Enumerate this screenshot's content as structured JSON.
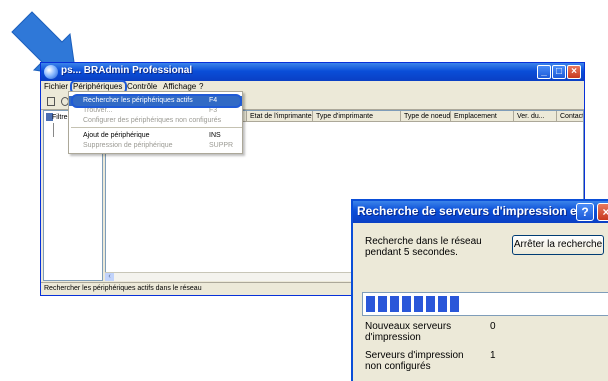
{
  "window": {
    "title": "ps... BRAdmin Professional",
    "menu": [
      "Fichier",
      "Périphériques",
      "Contrôle",
      "Affichage",
      "?"
    ]
  },
  "tree": {
    "filter_label": "Filtre"
  },
  "list": {
    "columns": [
      "...",
      "Etat de l'imprimante",
      "Type d'imprimante",
      "Type de noeud",
      "Emplacement",
      "Ver. du...",
      "Contact"
    ]
  },
  "status_bar": "Rechercher les périphériques actifs dans le réseau",
  "dropdown": {
    "items": [
      {
        "label": "Rechercher les périphériques actifs",
        "shortcut": "F4",
        "state": "selected"
      },
      {
        "label": "Trouver...",
        "shortcut": "F3",
        "state": "disabled"
      },
      {
        "label": "Configurer des périphériques non configurés",
        "shortcut": "",
        "state": "disabled"
      },
      {
        "label": "Ajout de périphérique",
        "shortcut": "INS",
        "state": "normal"
      },
      {
        "label": "Suppression de périphérique",
        "shortcut": "SUPPR",
        "state": "disabled"
      }
    ]
  },
  "dialog": {
    "title": "Recherche de serveurs d'impression e...",
    "message": "Recherche dans le réseau pendant 5 secondes.",
    "stop_button": "Arrêter la recherche",
    "progress_blocks": 8,
    "new_servers_label": "Nouveaux serveurs d'impression",
    "new_servers_value": "0",
    "unconfigured_label": "Serveurs d'impression non configurés",
    "unconfigured_value": "1"
  },
  "colors": {
    "xp_blue": "#0a4ed8",
    "highlight": "#1f5ad6",
    "selection": "#316ac5",
    "arrow": "#2f78d8"
  }
}
